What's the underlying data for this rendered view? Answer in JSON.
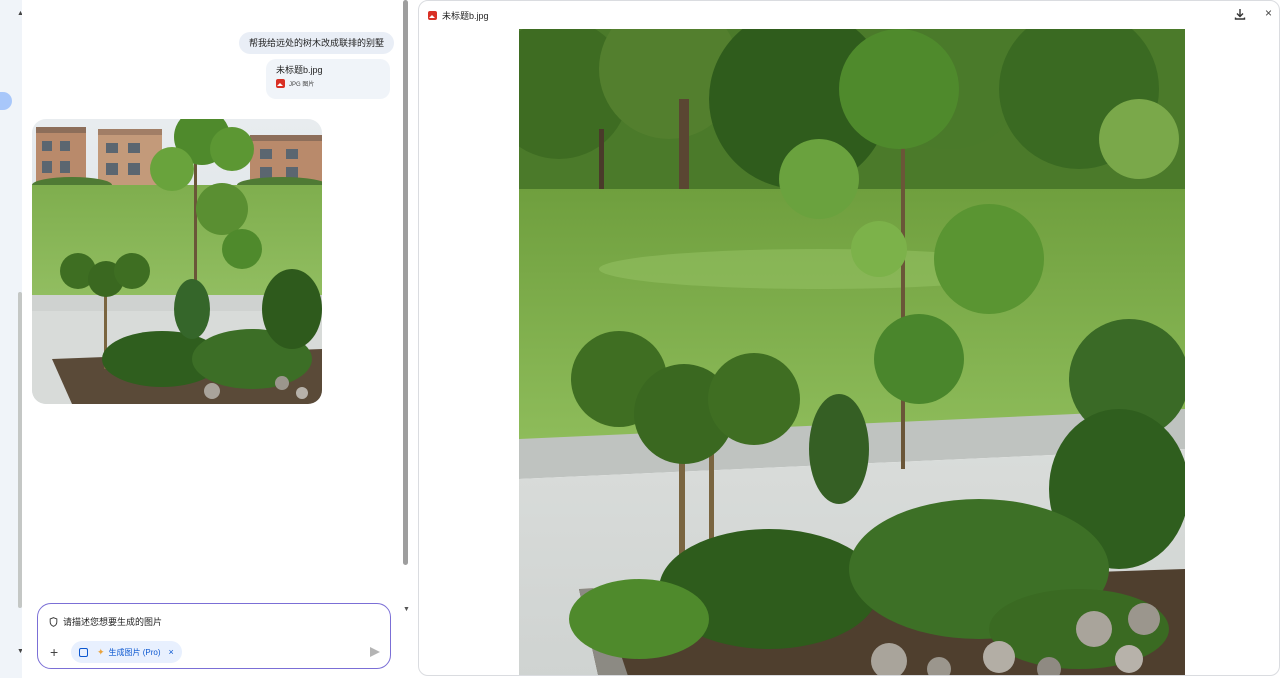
{
  "chat": {
    "user_message": "帮我给远处的树木改成联排的别墅",
    "attachment": {
      "file_name": "未标题b.jpg",
      "file_type": "JPG 图片",
      "icon": "image-file-icon"
    }
  },
  "composer": {
    "placeholder": "请描述您想要生成的图片",
    "tool_chip_label": "生成图片 (Pro)",
    "plus_label": "+",
    "close_label": "×"
  },
  "viewer": {
    "title": "未标题b.jpg",
    "close_label": "×"
  },
  "colors": {
    "accent": "#0b57d0",
    "composer_border": "#7b6fd6",
    "bubble_bg": "#e9eef6",
    "file_icon": "#d93025"
  }
}
